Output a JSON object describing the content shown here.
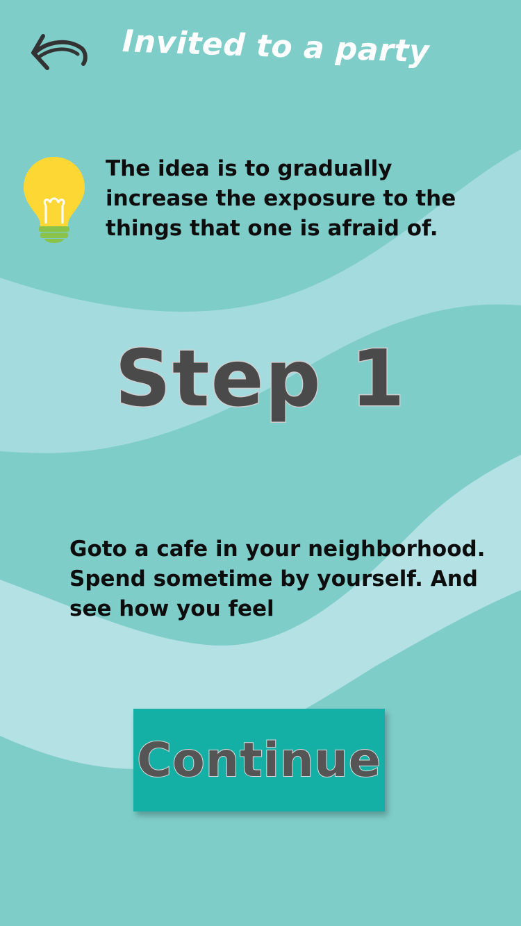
{
  "header": {
    "title": "Invited to a party",
    "back_icon": "back-arrow-icon"
  },
  "tip": {
    "icon": "lightbulb-icon",
    "text": "The idea is to gradually increase the exposure to the things that one is afraid of."
  },
  "step": {
    "title": "Step 1",
    "description": "Goto a cafe in your neighborhood. Spend sometime by yourself. And see how you feel"
  },
  "actions": {
    "continue_label": "Continue"
  },
  "colors": {
    "background": "#7ecdc9",
    "wave_light": "#b3e1e4",
    "button": "#14afa5",
    "bulb": "#fdd835",
    "bulb_base": "#8bc34a"
  }
}
